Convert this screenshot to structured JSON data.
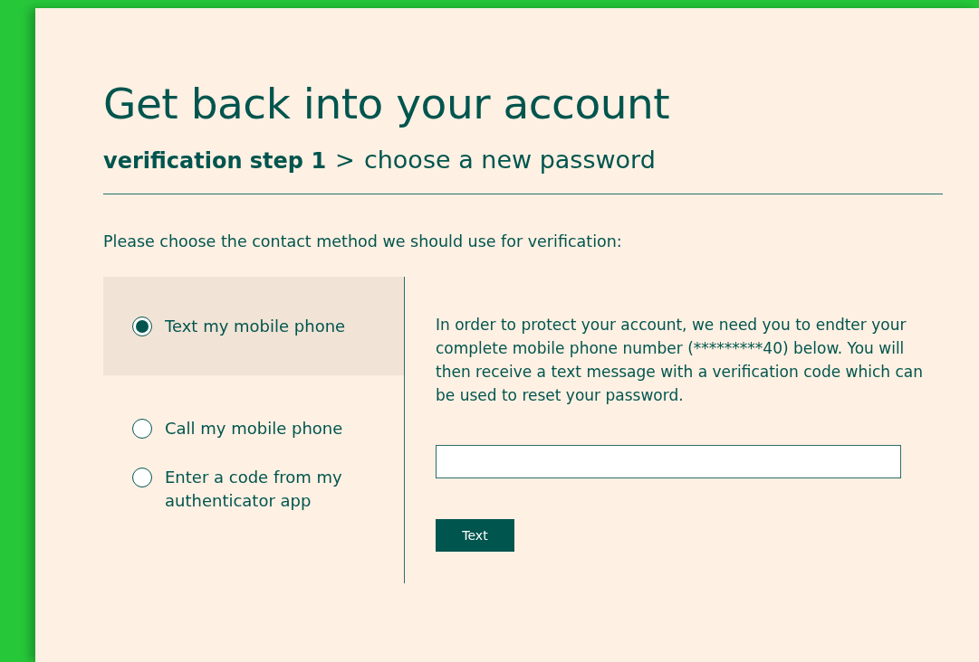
{
  "title": "Get back into your account",
  "steps": [
    {
      "label": "verification step 1",
      "selected": true
    },
    {
      "label": "choose a new password",
      "selected": false
    }
  ],
  "step_separator": ">",
  "prompt": "Please choose the contact method we should use for verification:",
  "methods": [
    {
      "label": "Text my mobile phone",
      "selected": true
    },
    {
      "label": "Call my mobile phone",
      "selected": false
    },
    {
      "label": "Enter a code from my authenticator app",
      "selected": false
    }
  ],
  "instructions": "In order to protect your account, we need you to endter your complete mobile phone number (*********40) below. You will then receive a text message with a verification code which can be used to reset your password.",
  "submit_button": "Text"
}
